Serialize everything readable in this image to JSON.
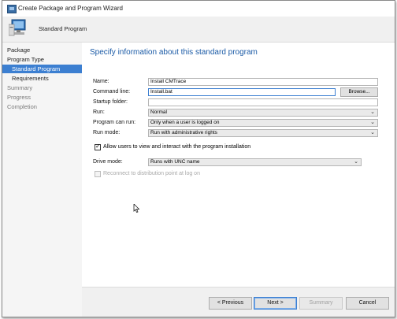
{
  "window": {
    "title": "Create Package and Program Wizard",
    "header_title": "Standard Program",
    "icon": "computer-setup-icon"
  },
  "nav": {
    "items": [
      {
        "label": "Package",
        "state": "done"
      },
      {
        "label": "Program Type",
        "state": "done"
      },
      {
        "label": "Standard Program",
        "state": "active"
      },
      {
        "label": "Requirements",
        "state": "done"
      },
      {
        "label": "Summary",
        "state": "pending"
      },
      {
        "label": "Progress",
        "state": "pending"
      },
      {
        "label": "Completion",
        "state": "pending"
      }
    ]
  },
  "main": {
    "title": "Specify information about this standard program",
    "name_label": "Name:",
    "name_value": "Install CMTrace",
    "command_label": "Command line:",
    "command_value": "Install.bat",
    "browse_label": "Browse...",
    "startup_label": "Startup folder:",
    "startup_value": "",
    "run_label": "Run:",
    "run_value": "Normal",
    "can_run_label": "Program can run:",
    "can_run_value": "Only when a user is logged on",
    "run_mode_label": "Run mode:",
    "run_mode_value": "Run with administrative rights",
    "allow_label": "Allow users to view and interact with the program installation",
    "allow_checked": true,
    "drive_label": "Drive mode:",
    "drive_value": "Runs with UNC name",
    "reconnect_label": "Reconnect to distribution point at log on",
    "reconnect_checked": false
  },
  "footer": {
    "previous_label": "< Previous",
    "next_label": "Next >",
    "summary_label": "Summary",
    "cancel_label": "Cancel"
  },
  "colors": {
    "accent": "#3c7fd1",
    "title_blue": "#1a5aa6"
  }
}
